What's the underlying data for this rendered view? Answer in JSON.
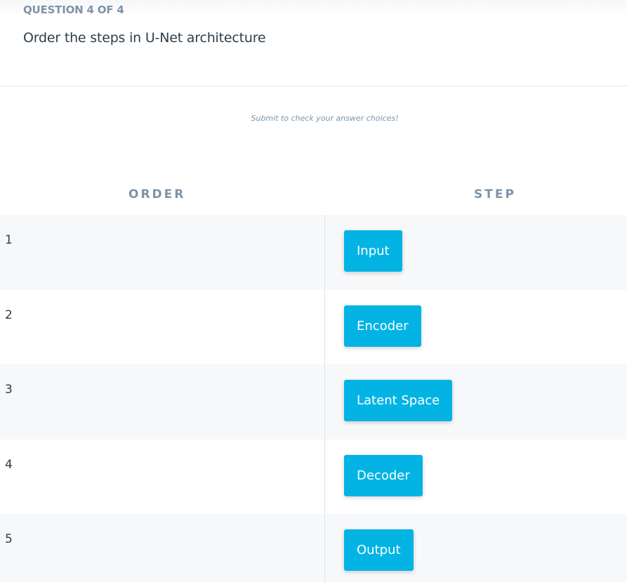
{
  "question": {
    "label": "QUESTION 4 OF 4",
    "title": "Order the steps in U-Net architecture"
  },
  "hint": "Submit to check your answer choices!",
  "columns": {
    "order": "ORDER",
    "step": "STEP"
  },
  "rows": [
    {
      "order": "1",
      "step": "Input"
    },
    {
      "order": "2",
      "step": "Encoder"
    },
    {
      "order": "3",
      "step": "Latent Space"
    },
    {
      "order": "4",
      "step": "Decoder"
    },
    {
      "order": "5",
      "step": "Output"
    }
  ],
  "colors": {
    "accent": "#02b3e4",
    "muted": "#7d93a8",
    "text": "#2e3d49",
    "row_shade": "#f7f8fa"
  }
}
